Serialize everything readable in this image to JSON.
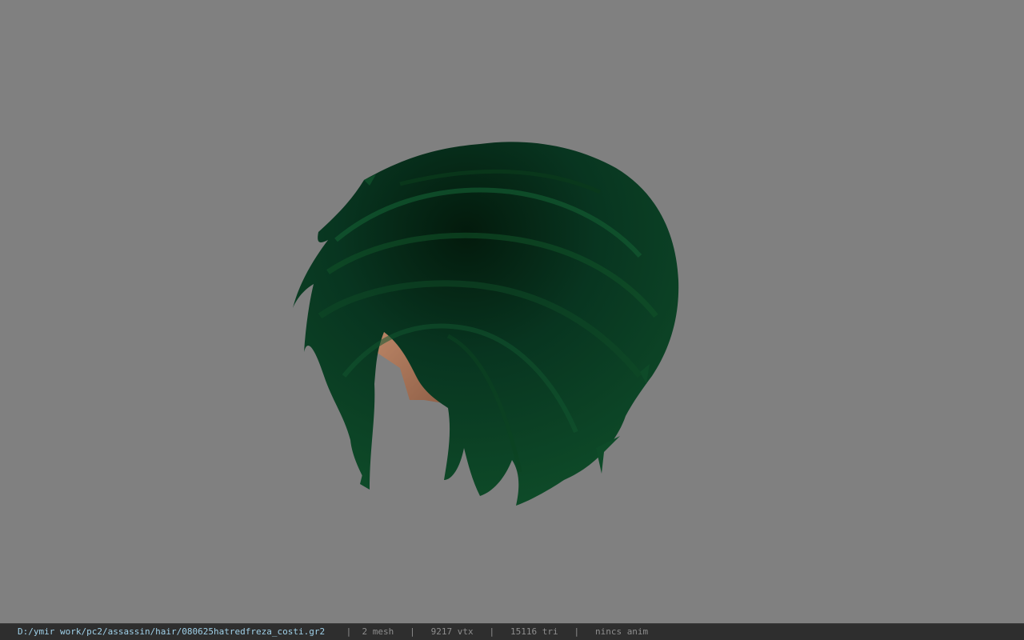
{
  "viewport": {
    "background_color": "#808080",
    "model": {
      "kind": "hair-mesh",
      "hair_color": "#0b3d1e",
      "skin_color": "#a87458"
    }
  },
  "status_bar": {
    "file_path": "D:/ymir work/pc2/assassin/hair/080625hatredfreza_costi.gr2",
    "separator": "|",
    "mesh_count": "2 mesh",
    "vertex_count": "9217 vtx",
    "triangle_count": "15116 tri",
    "anim_status": "nincs anim"
  }
}
